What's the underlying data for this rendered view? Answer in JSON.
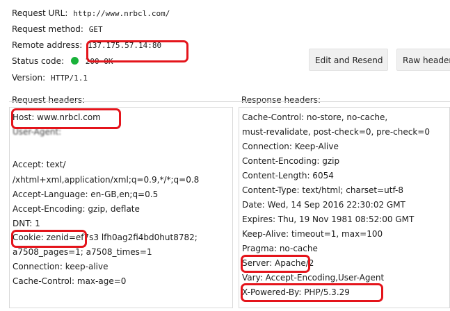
{
  "summary": {
    "url_label": "Request URL:",
    "url_value": "http://www.nrbcl.com/",
    "method_label": "Request method:",
    "method_value": "GET",
    "remote_label": "Remote address:",
    "remote_value": "137.175.57.14:80",
    "status_label": "Status code:",
    "status_value": "200 OK",
    "status_color": "#19b23a",
    "version_label": "Version:",
    "version_value": "HTTP/1.1"
  },
  "actions": {
    "edit_resend_label": "Edit and Resend",
    "raw_headers_label": "Raw headers"
  },
  "request_panel": {
    "title": "Request headers:",
    "lines": [
      "Host: www.nrbcl.com",
      "User-Agent:",
      "",
      "",
      "Accept: text/",
      "/xhtml+xml,application/xml;q=0.9,*/*;q=0.8",
      "Accept-Language: en-GB,en;q=0.5",
      "Accept-Encoding: gzip, deflate",
      "DNT: 1",
      "Cookie: zenid=ef7s3 lfh0ag2fi4bd0hut8782;",
      "a7508_pages=1; a7508_times=1",
      "Connection: keep-alive",
      "Cache-Control: max-age=0"
    ]
  },
  "response_panel": {
    "title": "Response headers:",
    "lines": [
      "Cache-Control: no-store, no-cache,",
      "must-revalidate, post-check=0, pre-check=0",
      "Connection: Keep-Alive",
      "Content-Encoding: gzip",
      "Content-Length: 6054",
      "Content-Type: text/html; charset=utf-8",
      "Date: Wed, 14 Sep 2016 22:30:02 GMT",
      "Expires: Thu, 19 Nov 1981 08:52:00 GMT",
      "Keep-Alive: timeout=1, max=100",
      "Pragma: no-cache",
      "Server: Apache/2",
      "Vary: Accept-Encoding,User-Agent",
      "X-Powered-By: PHP/5.3.29"
    ]
  },
  "annotation": {
    "highlight_color": "#e4141b"
  }
}
